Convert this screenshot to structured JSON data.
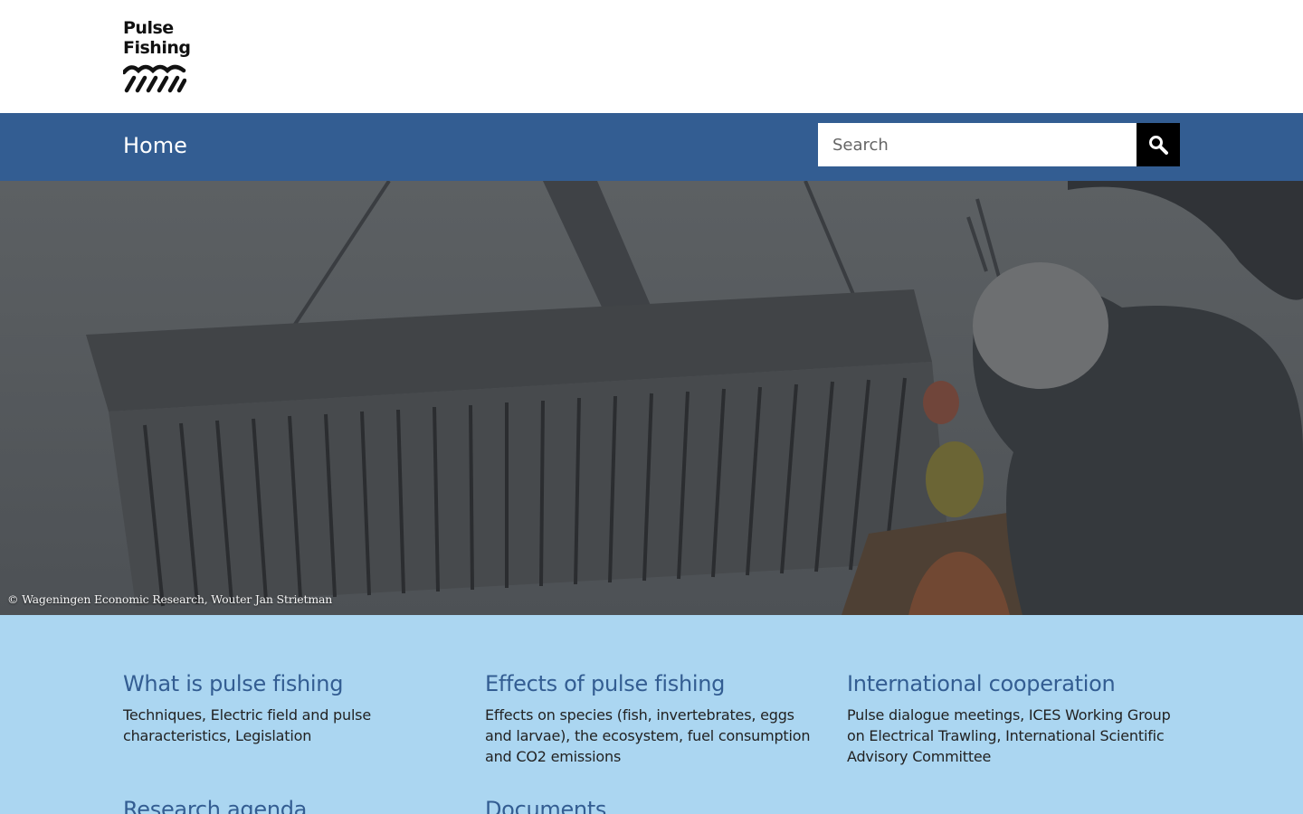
{
  "logo": {
    "line1": "Pulse",
    "line2": "Fishing"
  },
  "nav": {
    "home_label": "Home"
  },
  "search": {
    "placeholder": "Search"
  },
  "hero": {
    "caption": "© Wageningen Economic Research, Wouter Jan Strietman"
  },
  "topics": [
    {
      "title": "What is pulse fishing",
      "description": "Techniques, Electric field and pulse characteristics, Legislation"
    },
    {
      "title": "Effects of pulse fishing",
      "description": "Effects on species (fish, invertebrates, eggs and larvae), the ecosystem, fuel consumption and CO2 emissions"
    },
    {
      "title": "International cooperation",
      "description": "Pulse dialogue meetings, ICES Working Group on Electrical Trawling, International Scientific Advisory Committee"
    },
    {
      "title": "Research agenda",
      "description": ""
    },
    {
      "title": "Documents",
      "description": ""
    }
  ],
  "colors": {
    "nav_bg": "#335d92",
    "topics_bg": "#abd6f1",
    "topic_title": "#335d92"
  }
}
